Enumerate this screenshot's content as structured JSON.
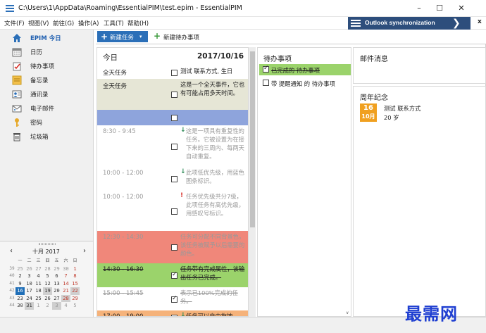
{
  "window": {
    "title": "C:\\Users\\1\\AppData\\Roaming\\EssentialPIM\\test.epim - EssentialPIM",
    "minimize": "–",
    "maximize": "☐",
    "close": "✕"
  },
  "menu": [
    "文件(F)",
    "视图(V)",
    "前往(G)",
    "操作(A)",
    "工具(T)",
    "帮助(H)"
  ],
  "sync": {
    "label": "Outlook synchronization",
    "chevron": "❯",
    "close": "x"
  },
  "toolbar": {
    "new_task": "新建任务",
    "new_task_plus": "+",
    "new_task_dropdown": "▾",
    "new_todo_plus": "+",
    "new_todo": "新建待办事项"
  },
  "sidebar": {
    "items": [
      {
        "label": "EPIM 今日",
        "icon": "home-icon",
        "active": true
      },
      {
        "label": "日历",
        "icon": "calendar-icon"
      },
      {
        "label": "待办事项",
        "icon": "todo-icon"
      },
      {
        "label": "备忘录",
        "icon": "notes-icon"
      },
      {
        "label": "通讯录",
        "icon": "contacts-icon"
      },
      {
        "label": "电子邮件",
        "icon": "email-icon"
      },
      {
        "label": "密码",
        "icon": "key-icon"
      },
      {
        "label": "垃圾箱",
        "icon": "trash-icon"
      }
    ]
  },
  "mini_calendar": {
    "month_label": "十月  2017",
    "prev": "‹",
    "next": "›",
    "headers": [
      "周一",
      "周二",
      "周三",
      "周四",
      "周五",
      "周六",
      "周日"
    ],
    "weeks": [
      {
        "wk": "39",
        "days": [
          "25",
          "26",
          "27",
          "28",
          "29",
          "30",
          "1"
        ]
      },
      {
        "wk": "40",
        "days": [
          "2",
          "3",
          "4",
          "5",
          "6",
          "7",
          "8"
        ]
      },
      {
        "wk": "41",
        "days": [
          "9",
          "10",
          "11",
          "12",
          "13",
          "14",
          "15"
        ]
      },
      {
        "wk": "42",
        "days": [
          "16",
          "17",
          "18",
          "19",
          "20",
          "21",
          "22"
        ]
      },
      {
        "wk": "43",
        "days": [
          "23",
          "24",
          "25",
          "26",
          "27",
          "28",
          "29"
        ]
      },
      {
        "wk": "44",
        "days": [
          "30",
          "31",
          "1",
          "2",
          "3",
          "4",
          "5"
        ]
      }
    ]
  },
  "today": {
    "title": "今日",
    "date": "2017/10/16",
    "rows": [
      {
        "time": "全天任务",
        "text": "测试 联系方式, 生日",
        "checked": false,
        "bg": "#ffffff",
        "mark": ""
      },
      {
        "time": "全天任务",
        "text": "这是一个全天事件，它也有可能占用多天时间。",
        "checked": false,
        "bg": "#e6e6d6",
        "mark": ""
      },
      {
        "time": "",
        "text": "",
        "checked": false,
        "bg": "#8ea4dc",
        "mark": ""
      },
      {
        "time": "8:30 - 9:45",
        "text": "这是一项具有重复性的任务。它被设置为在接下来的三周内、每两天自动重复。",
        "checked": false,
        "bg": "#ffffff",
        "mark": "↓",
        "mark_color": "#2e8b57",
        "gray": true
      },
      {
        "time": "10:00 - 12:00",
        "text": "此项低优先级，用蓝色图条标识。",
        "checked": false,
        "bg": "#ffffff",
        "mark": "↓",
        "mark_color": "#2e8b57",
        "gray": true
      },
      {
        "time": "10:00 - 12:00",
        "text": "任务优先级共分7级，此项任务有高优先级，用感叹号标识。",
        "checked": false,
        "bg": "#ffffff",
        "mark": "!",
        "mark_color": "#d9302a",
        "gray": true
      },
      {
        "time": "12:30 - 14:30",
        "text": "任务可分配不同背景色，该任务被赋予以后需要的颜色。",
        "checked": false,
        "bg": "#f0877a",
        "mark": "",
        "gray": true
      },
      {
        "time": "14:30 - 16:30",
        "text": "任务带有完成属性，该输出任务已完成。",
        "checked": true,
        "bg": "#9bd36b",
        "mark": "",
        "strike": true
      },
      {
        "time": "15:00 - 15:45",
        "text": "表示已100%完成的任务。",
        "checked": true,
        "bg": "#ffffff",
        "mark": "",
        "strike": true,
        "gray": true
      },
      {
        "time": "17:00 - 19:00",
        "text": "任务可以自由拖拽",
        "checked": false,
        "bg": "#f5b27a",
        "mark": "↓",
        "mark_color": "#2e8b57"
      }
    ]
  },
  "todo": {
    "title": "待办事项",
    "items": [
      {
        "label": "已完成的 待办事项",
        "checked": true,
        "bg": "#9bd36b",
        "strike": true
      },
      {
        "label": "带 提醒通知 的 待办事项",
        "checked": false,
        "bg": "#ffffff",
        "strike": false
      }
    ]
  },
  "mail": {
    "title": "邮件消息"
  },
  "anniversary": {
    "title": "周年纪念",
    "day": "16",
    "month": "10月",
    "name": "测试 联系方式",
    "age": "20 岁"
  },
  "watermark": "最需网"
}
